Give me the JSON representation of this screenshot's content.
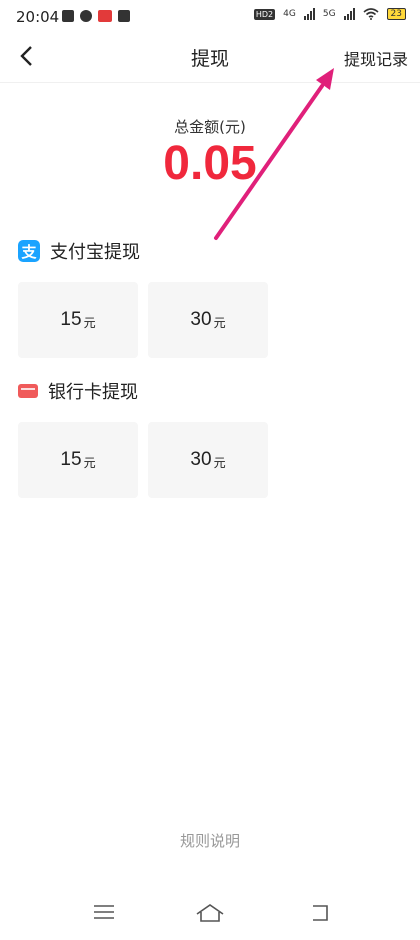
{
  "status_bar": {
    "time": "20:04",
    "hd": "HD2",
    "net1": "4G",
    "net2": "5G",
    "battery": "23"
  },
  "header": {
    "title": "提现",
    "record_link": "提现记录"
  },
  "summary": {
    "label": "总金额(元)",
    "amount": "0.05"
  },
  "alipay": {
    "title": "支付宝提现",
    "icon_glyph": "支",
    "options": [
      {
        "amount": "15",
        "unit": "元"
      },
      {
        "amount": "30",
        "unit": "元"
      }
    ]
  },
  "bank": {
    "title": "银行卡提现",
    "options": [
      {
        "amount": "15",
        "unit": "元"
      },
      {
        "amount": "30",
        "unit": "元"
      }
    ]
  },
  "footer": {
    "rules_link": "规则说明"
  },
  "colors": {
    "amount": "#f0283c",
    "alipay_blue": "#1aa3ff",
    "card_red": "#f05a5a",
    "annotation_arrow": "#e0207a"
  }
}
